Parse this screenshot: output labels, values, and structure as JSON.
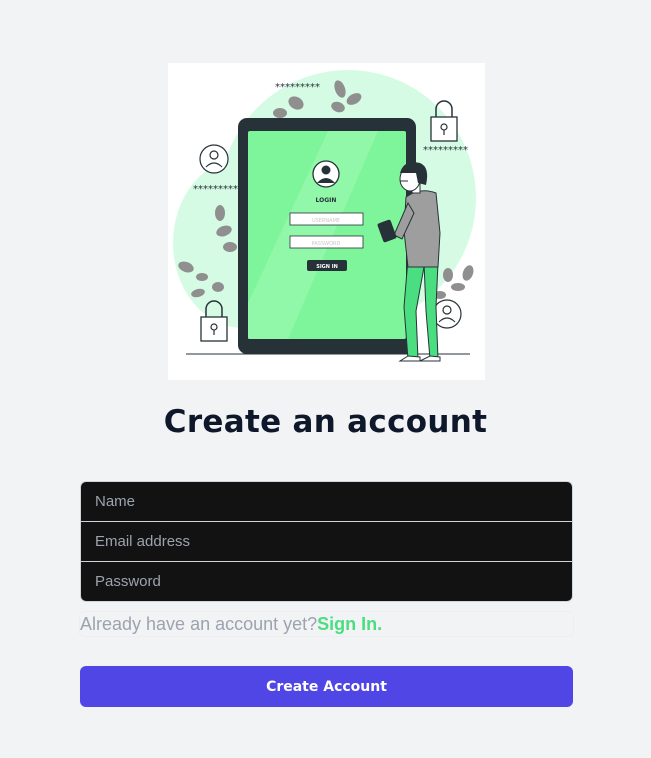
{
  "illustration": {
    "stars_top": "*********",
    "stars_left": "*********",
    "stars_right": "*********",
    "screen_login": "LOGIN",
    "screen_username": "USERNAME",
    "screen_password": "PASSWORD",
    "screen_signin": "SIGN IN",
    "colors": {
      "blob": "#d6fbe4",
      "screen": "#7ef59a",
      "device": "#263238",
      "leaves": "#8f8f8f",
      "accent": "#4ade80"
    }
  },
  "page": {
    "title": "Create an account"
  },
  "form": {
    "name_placeholder": "Name",
    "email_placeholder": "Email address",
    "password_placeholder": "Password",
    "have_account_text": "Already have an account yet?",
    "signin_link": "Sign In.",
    "submit_label": "Create Account"
  },
  "colors": {
    "background": "#f2f3f5",
    "title": "#0f172a",
    "input_bg": "#121212",
    "link": "#4ade80",
    "button": "#4f46e5"
  }
}
